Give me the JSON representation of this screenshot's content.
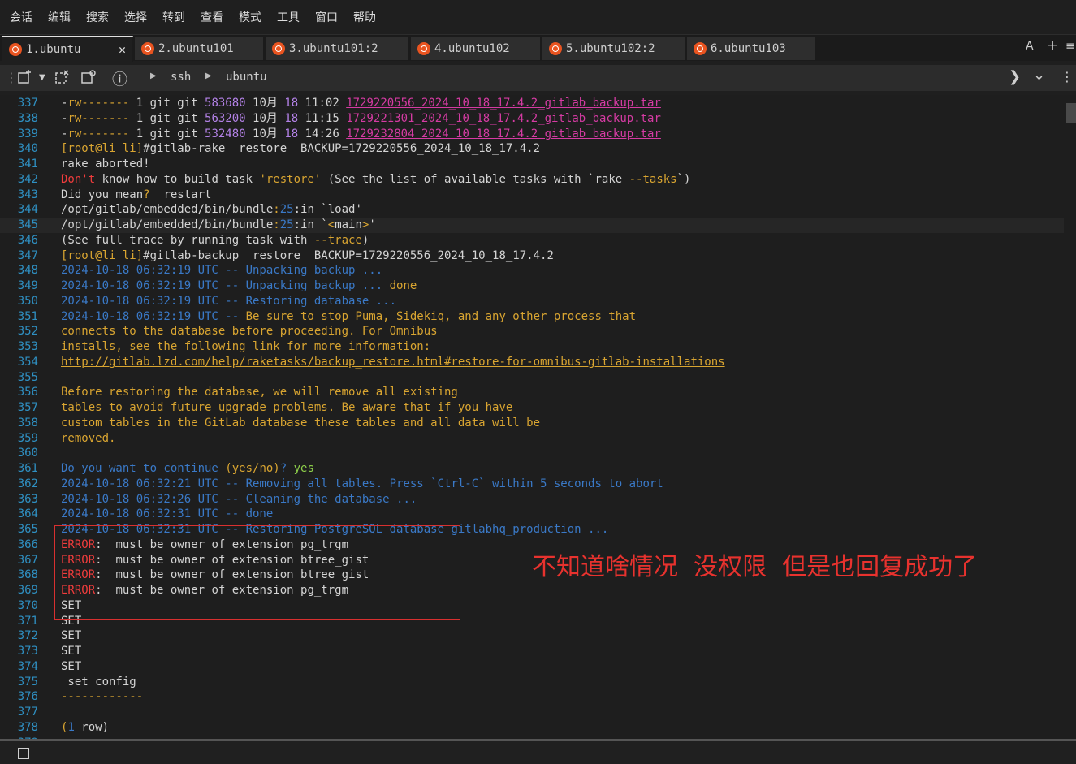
{
  "menubar": {
    "items": [
      "会话",
      "编辑",
      "搜索",
      "选择",
      "转到",
      "查看",
      "模式",
      "工具",
      "窗口",
      "帮助"
    ]
  },
  "tabs": [
    {
      "label": "1.ubuntu"
    },
    {
      "label": "2.ubuntu101"
    },
    {
      "label": "3.ubuntu101:2"
    },
    {
      "label": "4.ubuntu102"
    },
    {
      "label": "5.ubuntu102:2"
    },
    {
      "label": "6.ubuntu103"
    }
  ],
  "tabbar": {
    "close": "✕",
    "font_label": "A",
    "add": "+",
    "menu": "≡"
  },
  "toolbar": {
    "crumbs": [
      "ssh",
      "ubuntu"
    ],
    "info": "ⓘ",
    "next": "❯",
    "dropdown": "⌄",
    "more": "⋮"
  },
  "colors": {
    "default": "#d4d4d4",
    "yellow": "#d9a531",
    "blue": "#3a79c7",
    "green": "#8ed04a",
    "red": "#f03c3c",
    "magenta": "#d53ba3",
    "purple": "#b482e8",
    "annotation": "#e8322e"
  },
  "terminal": {
    "lines": [
      {
        "n": "337",
        "segs": [
          {
            "t": "-",
            "c": "default"
          },
          {
            "t": "rw-------",
            "c": "yellow"
          },
          {
            "t": " 1 git git ",
            "c": "default"
          },
          {
            "t": "583680",
            "c": "purple"
          },
          {
            "t": " 10月 ",
            "c": "default"
          },
          {
            "t": "18",
            "c": "purple"
          },
          {
            "t": " 11:02 ",
            "c": "default"
          },
          {
            "t": "1729220556_2024_10_18_17.4.2_gitlab_backup.tar",
            "c": "magenta",
            "u": true
          }
        ]
      },
      {
        "n": "338",
        "segs": [
          {
            "t": "-",
            "c": "default"
          },
          {
            "t": "rw-------",
            "c": "yellow"
          },
          {
            "t": " 1 git git ",
            "c": "default"
          },
          {
            "t": "563200",
            "c": "purple"
          },
          {
            "t": " 10月 ",
            "c": "default"
          },
          {
            "t": "18",
            "c": "purple"
          },
          {
            "t": " 11:15 ",
            "c": "default"
          },
          {
            "t": "1729221301_2024_10_18_17.4.2_gitlab_backup.tar",
            "c": "magenta",
            "u": true
          }
        ]
      },
      {
        "n": "339",
        "segs": [
          {
            "t": "-",
            "c": "default"
          },
          {
            "t": "rw-------",
            "c": "yellow"
          },
          {
            "t": " 1 git git ",
            "c": "default"
          },
          {
            "t": "532480",
            "c": "purple"
          },
          {
            "t": " 10月 ",
            "c": "default"
          },
          {
            "t": "18",
            "c": "purple"
          },
          {
            "t": " 14:26 ",
            "c": "default"
          },
          {
            "t": "1729232804_2024_10_18_17.4.2_gitlab_backup.tar",
            "c": "magenta",
            "u": true
          }
        ]
      },
      {
        "n": "340",
        "segs": [
          {
            "t": "[root@li li]",
            "c": "yellow"
          },
          {
            "t": "#gitlab-rake  restore  BACKUP=1729220556_2024_10_18_17.4.2",
            "c": "default"
          }
        ]
      },
      {
        "n": "341",
        "segs": [
          {
            "t": "rake aborted!",
            "c": "default"
          }
        ]
      },
      {
        "n": "342",
        "segs": [
          {
            "t": "Don't",
            "c": "red"
          },
          {
            "t": " know how to build task ",
            "c": "default"
          },
          {
            "t": "'restore'",
            "c": "yellow"
          },
          {
            "t": " (See the list of available tasks with `rake ",
            "c": "default"
          },
          {
            "t": "--tasks",
            "c": "yellow"
          },
          {
            "t": "`)",
            "c": "default"
          }
        ]
      },
      {
        "n": "343",
        "segs": [
          {
            "t": "Did you mean",
            "c": "default"
          },
          {
            "t": "?",
            "c": "yellow"
          },
          {
            "t": "  restart",
            "c": "default"
          }
        ]
      },
      {
        "n": "344",
        "segs": [
          {
            "t": "/opt/gitlab/embedded/bin/bundle",
            "c": "default"
          },
          {
            "t": ":",
            "c": "yellow"
          },
          {
            "t": "25",
            "c": "blue"
          },
          {
            "t": ":in `load'",
            "c": "default"
          }
        ]
      },
      {
        "n": "345",
        "hl": true,
        "segs": [
          {
            "t": "/opt/gitlab/embedded/bin/bundle",
            "c": "default"
          },
          {
            "t": ":",
            "c": "yellow"
          },
          {
            "t": "25",
            "c": "blue"
          },
          {
            "t": ":in `",
            "c": "default"
          },
          {
            "t": "<",
            "c": "yellow"
          },
          {
            "t": "main",
            "c": "default"
          },
          {
            "t": ">",
            "c": "yellow"
          },
          {
            "t": "'",
            "c": "default"
          }
        ]
      },
      {
        "n": "346",
        "segs": [
          {
            "t": "(See full trace by running task with ",
            "c": "default"
          },
          {
            "t": "--trace",
            "c": "yellow"
          },
          {
            "t": ")",
            "c": "default"
          }
        ]
      },
      {
        "n": "347",
        "segs": [
          {
            "t": "[root@li li]",
            "c": "yellow"
          },
          {
            "t": "#gitlab-backup  restore  BACKUP=1729220556_2024_10_18_17.4.2",
            "c": "default"
          }
        ]
      },
      {
        "n": "348",
        "segs": [
          {
            "t": "2024-10-18 06:32:19 UTC -- ",
            "c": "blue"
          },
          {
            "t": "Unpacking backup ...",
            "c": "blue"
          }
        ]
      },
      {
        "n": "349",
        "segs": [
          {
            "t": "2024-10-18 06:32:19 UTC -- ",
            "c": "blue"
          },
          {
            "t": "Unpacking backup ... ",
            "c": "blue"
          },
          {
            "t": "done",
            "c": "yellow"
          }
        ]
      },
      {
        "n": "350",
        "segs": [
          {
            "t": "2024-10-18 06:32:19 UTC -- ",
            "c": "blue"
          },
          {
            "t": "Restoring database ...",
            "c": "blue"
          }
        ]
      },
      {
        "n": "351",
        "segs": [
          {
            "t": "2024-10-18 06:32:19 UTC -- ",
            "c": "blue"
          },
          {
            "t": "Be sure to stop Puma, Sidekiq, and any other process that",
            "c": "yellow"
          }
        ]
      },
      {
        "n": "352",
        "segs": [
          {
            "t": "connects to the database before proceeding. For Omnibus",
            "c": "yellow"
          }
        ]
      },
      {
        "n": "353",
        "segs": [
          {
            "t": "installs, see the following link for more information:",
            "c": "yellow"
          }
        ]
      },
      {
        "n": "354",
        "segs": [
          {
            "t": "http://gitlab.lzd.com/help/raketasks/backup_restore.html#restore-for-omnibus-gitlab-installations",
            "c": "yellow",
            "u": true
          }
        ]
      },
      {
        "n": "355",
        "segs": []
      },
      {
        "n": "356",
        "segs": [
          {
            "t": "Before restoring the database, we will remove all existing",
            "c": "yellow"
          }
        ]
      },
      {
        "n": "357",
        "segs": [
          {
            "t": "tables to avoid future upgrade problems. Be aware that if you have",
            "c": "yellow"
          }
        ]
      },
      {
        "n": "358",
        "segs": [
          {
            "t": "custom tables in the GitLab database these tables and all data will be",
            "c": "yellow"
          }
        ]
      },
      {
        "n": "359",
        "segs": [
          {
            "t": "removed.",
            "c": "yellow"
          }
        ]
      },
      {
        "n": "360",
        "segs": []
      },
      {
        "n": "361",
        "segs": [
          {
            "t": "Do you want to continue ",
            "c": "blue"
          },
          {
            "t": "(yes/no)",
            "c": "yellow"
          },
          {
            "t": "? ",
            "c": "blue"
          },
          {
            "t": "yes",
            "c": "green"
          }
        ]
      },
      {
        "n": "362",
        "segs": [
          {
            "t": "2024-10-18 06:32:21 UTC -- ",
            "c": "blue"
          },
          {
            "t": "Removing all tables. Press `Ctrl-C` within 5 seconds to abort",
            "c": "blue"
          }
        ]
      },
      {
        "n": "363",
        "segs": [
          {
            "t": "2024-10-18 06:32:26 UTC -- ",
            "c": "blue"
          },
          {
            "t": "Cleaning the database ...",
            "c": "blue"
          }
        ]
      },
      {
        "n": "364",
        "segs": [
          {
            "t": "2024-10-18 06:32:31 UTC -- ",
            "c": "blue"
          },
          {
            "t": "done",
            "c": "blue"
          }
        ]
      },
      {
        "n": "365",
        "segs": [
          {
            "t": "2024-10-18 06:32:31 UTC -- ",
            "c": "blue"
          },
          {
            "t": "Restoring PostgreSQL database gitlabhq_production ...",
            "c": "blue"
          }
        ]
      },
      {
        "n": "366",
        "segs": [
          {
            "t": "ERROR",
            "c": "red"
          },
          {
            "t": ":  must be owner of extension pg_trgm",
            "c": "default"
          }
        ]
      },
      {
        "n": "367",
        "segs": [
          {
            "t": "ERROR",
            "c": "red"
          },
          {
            "t": ":  must be owner of extension btree_gist",
            "c": "default"
          }
        ]
      },
      {
        "n": "368",
        "segs": [
          {
            "t": "ERROR",
            "c": "red"
          },
          {
            "t": ":  must be owner of extension btree_gist",
            "c": "default"
          }
        ]
      },
      {
        "n": "369",
        "segs": [
          {
            "t": "ERROR",
            "c": "red"
          },
          {
            "t": ":  must be owner of extension pg_trgm",
            "c": "default"
          }
        ]
      },
      {
        "n": "370",
        "segs": [
          {
            "t": "SET",
            "c": "default"
          }
        ]
      },
      {
        "n": "371",
        "segs": [
          {
            "t": "SET",
            "c": "default"
          }
        ]
      },
      {
        "n": "372",
        "segs": [
          {
            "t": "SET",
            "c": "default"
          }
        ]
      },
      {
        "n": "373",
        "segs": [
          {
            "t": "SET",
            "c": "default"
          }
        ]
      },
      {
        "n": "374",
        "segs": [
          {
            "t": "SET",
            "c": "default"
          }
        ]
      },
      {
        "n": "375",
        "segs": [
          {
            "t": " set_config",
            "c": "default"
          }
        ]
      },
      {
        "n": "376",
        "segs": [
          {
            "t": "------------",
            "c": "yellow"
          }
        ]
      },
      {
        "n": "377",
        "segs": []
      },
      {
        "n": "378",
        "segs": [
          {
            "t": "(",
            "c": "yellow"
          },
          {
            "t": "1",
            "c": "blue"
          },
          {
            "t": " row)",
            "c": "default"
          }
        ]
      },
      {
        "n": "379",
        "segs": []
      }
    ]
  },
  "annotation": {
    "text": "不知道啥情况  没权限  但是也回复成功了"
  }
}
